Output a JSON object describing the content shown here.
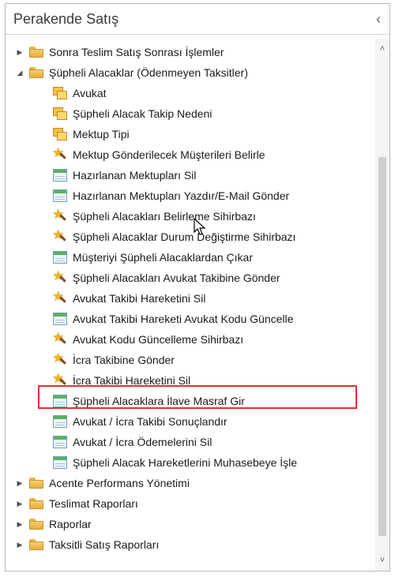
{
  "panel": {
    "title": "Perakende Satış",
    "collapse_glyph": "‹"
  },
  "tree": {
    "items": [
      {
        "label": "Sonra Teslim Satış Sonrası İşlemler",
        "icon": "folder-icon",
        "level": 0,
        "expander": "collapsed"
      },
      {
        "label": "Şüpheli Alacaklar (Ödenmeyen Taksitler)",
        "icon": "folder-icon",
        "level": 0,
        "expander": "expanded"
      },
      {
        "label": "Avukat",
        "icon": "multi-document-icon",
        "level": 1
      },
      {
        "label": "Şüpheli Alacak Takip Nedeni",
        "icon": "multi-document-icon",
        "level": 1
      },
      {
        "label": "Mektup Tipi",
        "icon": "multi-document-icon",
        "level": 1
      },
      {
        "label": "Mektup Gönderilecek Müşterileri Belirle",
        "icon": "wizard-icon",
        "level": 1
      },
      {
        "label": "Hazırlanan Mektupları Sil",
        "icon": "form-icon",
        "level": 1
      },
      {
        "label": "Hazırlanan Mektupları Yazdır/E-Mail Gönder",
        "icon": "form-icon",
        "level": 1
      },
      {
        "label": "Şüpheli Alacakları Belirleme Sihirbazı",
        "icon": "wizard-icon",
        "level": 1
      },
      {
        "label": "Şüpheli Alacaklar Durum Değiştirme Sihirbazı",
        "icon": "wizard-icon",
        "level": 1
      },
      {
        "label": "Müşteriyi Şüpheli Alacaklardan Çıkar",
        "icon": "form-icon",
        "level": 1
      },
      {
        "label": "Şüpheli Alacakları Avukat Takibine Gönder",
        "icon": "wizard-icon",
        "level": 1
      },
      {
        "label": "Avukat Takibi Hareketini Sil",
        "icon": "wizard-icon",
        "level": 1
      },
      {
        "label": "Avukat Takibi Hareketi Avukat Kodu Güncelle",
        "icon": "form-icon",
        "level": 1
      },
      {
        "label": "Avukat Kodu Güncelleme Sihirbazı",
        "icon": "wizard-icon",
        "level": 1
      },
      {
        "label": "İcra Takibine Gönder",
        "icon": "wizard-icon",
        "level": 1
      },
      {
        "label": "İcra Takibi Hareketini Sil",
        "icon": "wizard-icon",
        "level": 1,
        "highlighted": true
      },
      {
        "label": "Şüpheli Alacaklara İlave Masraf Gir",
        "icon": "form-icon",
        "level": 1
      },
      {
        "label": "Avukat / İcra Takibi Sonuçlandır",
        "icon": "form-icon",
        "level": 1
      },
      {
        "label": "Avukat / İcra Ödemelerini Sil",
        "icon": "form-icon",
        "level": 1
      },
      {
        "label": "Şüpheli Alacak Hareketlerini Muhasebeye İşle",
        "icon": "form-icon",
        "level": 1
      },
      {
        "label": "Acente Performans Yönetimi",
        "icon": "folder-icon",
        "level": 0,
        "expander": "collapsed"
      },
      {
        "label": "Teslimat Raporları",
        "icon": "folder-icon",
        "level": 0,
        "expander": "collapsed"
      },
      {
        "label": "Raporlar",
        "icon": "folder-icon",
        "level": 0,
        "expander": "collapsed"
      },
      {
        "label": "Taksitli Satış Raporları",
        "icon": "folder-icon",
        "level": 0,
        "expander": "collapsed"
      }
    ]
  },
  "scrollbar": {
    "up_glyph": "˄",
    "down_glyph": "˅"
  },
  "colors": {
    "highlight_border": "#e03030",
    "folder": "#f0c050",
    "form_header": "#58b35a"
  }
}
